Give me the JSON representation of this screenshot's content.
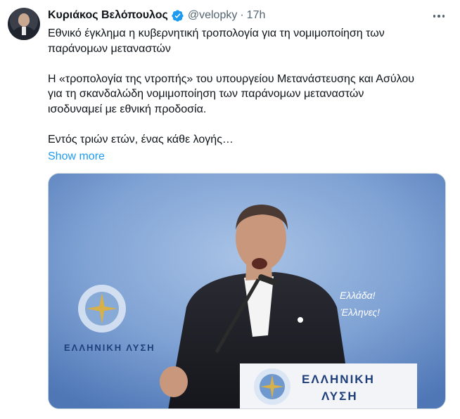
{
  "author": {
    "name": "Κυριάκος Βελόπουλος",
    "handle": "@velopky",
    "separator": "·",
    "time": "17h",
    "avatar_icon": "profile-photo"
  },
  "tweet": {
    "line1": "Εθνικό έγκλημα η κυβερνητική τροπολογία για τη νομιμοποίηση των",
    "line2": "παράνομων μεταναστών",
    "line3": "Η «τροπολογία της ντροπής» του υπουργείου Μετανάστευσης και Ασύλου",
    "line4": "για τη σκανδαλώδη νομιμοποίηση των παράνομων μεταναστών",
    "line5": "ισοδυναμεί με εθνική προδοσία.",
    "line6": "Εντός τριών ετών, ένας κάθε λογής…",
    "show_more": "Show more"
  },
  "media": {
    "banner_text_1": "Ελλάδα!",
    "banner_text_2": "ι Έλληνες!",
    "party_name": "ΕΛΛΗΝΙΚΗ ΛΥΣΗ",
    "podium_line1": "ΕΛΛΗΝΙΚΗ",
    "podium_line2": "ΛΥΣΗ"
  },
  "colors": {
    "accent": "#1d9bf0",
    "secondary_text": "#536471",
    "primary_text": "#0f1419",
    "backdrop": "#6e95cc"
  }
}
